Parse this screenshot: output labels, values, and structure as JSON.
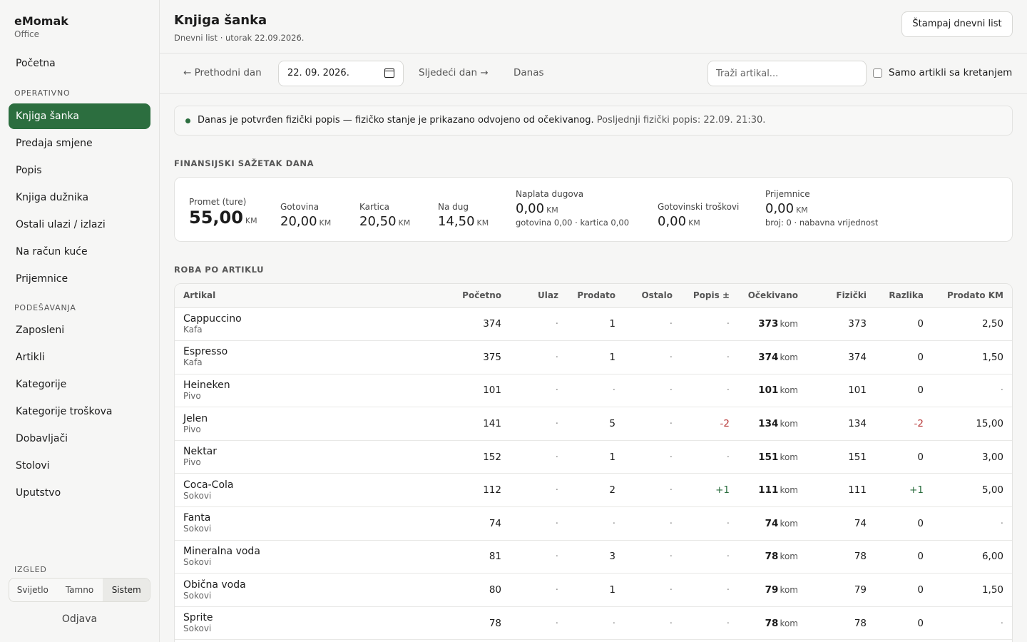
{
  "brand": {
    "name": "eMomak",
    "sub": "Office"
  },
  "nav": {
    "home": "Početna",
    "section_operative": "OPERATIVNO",
    "operative_items": [
      "Knjiga šanka",
      "Predaja smjene",
      "Popis",
      "Knjiga dužnika",
      "Ostali ulazi / izlazi",
      "Na račun kuće",
      "Prijemnice"
    ],
    "section_settings": "PODEŠAVANJA",
    "settings_items": [
      "Zaposleni",
      "Artikli",
      "Kategorije",
      "Kategorije troškova",
      "Dobavljači",
      "Stolovi",
      "Uputstvo"
    ],
    "section_appearance": "IZGLED",
    "theme_options": [
      "Svijetlo",
      "Tamno",
      "Sistem"
    ],
    "theme_selected": "Sistem",
    "logout": "Odjava"
  },
  "header": {
    "title": "Knjiga šanka",
    "subtitle": "Dnevni list · utorak 22.09.2026.",
    "print_button": "Štampaj dnevni list"
  },
  "toolbar": {
    "prev_day": "← Prethodni dan",
    "date_value": "22. 09. 2026.",
    "next_day": "Sljedeći dan →",
    "today": "Danas",
    "search_placeholder": "Traži artikal...",
    "movement_only_label": "Samo artikli sa kretanjem",
    "movement_only_checked": false
  },
  "notice": {
    "text": "Danas je potvrđen fizički popis — fizičko stanje je prikazano odvojeno od očekivanog.",
    "muted": "Posljednji fizički popis: 22.09. 21:30."
  },
  "summary": {
    "section_label": "FINANSIJSKI SAŽETAK DANA",
    "turnover": {
      "label": "Promet (ture)",
      "value": "55,00",
      "unit": "KM"
    },
    "cash": {
      "label": "Gotovina",
      "value": "20,00",
      "unit": "KM"
    },
    "card": {
      "label": "Kartica",
      "value": "20,50",
      "unit": "KM"
    },
    "debt": {
      "label": "Na dug",
      "value": "14,50",
      "unit": "KM"
    },
    "debt_collection": {
      "label": "Naplata dugova",
      "value": "0,00",
      "unit": "KM",
      "note": "gotovina 0,00 · kartica 0,00"
    },
    "cash_expenses": {
      "label": "Gotovinski troškovi",
      "value": "0,00",
      "unit": "KM"
    },
    "receipts": {
      "label": "Prijemnice",
      "value": "0,00",
      "unit": "KM",
      "note": "broj: 0 · nabavna vrijednost"
    }
  },
  "goods": {
    "section_label": "ROBA PO ARTIKLU",
    "columns": [
      "Artikal",
      "Početno",
      "Ulaz",
      "Prodato",
      "Ostalo",
      "Popis ±",
      "Očekivano",
      "Fizički",
      "Razlika",
      "Prodato KM"
    ],
    "unit": "kom",
    "rows": [
      {
        "name": "Cappuccino",
        "category": "Kafa",
        "start": "374",
        "in": "·",
        "sold": "1",
        "other": "·",
        "count": "·",
        "expected": "373",
        "physical": "373",
        "diff": "0",
        "sold_km": "2,50"
      },
      {
        "name": "Espresso",
        "category": "Kafa",
        "start": "375",
        "in": "·",
        "sold": "1",
        "other": "·",
        "count": "·",
        "expected": "374",
        "physical": "374",
        "diff": "0",
        "sold_km": "1,50"
      },
      {
        "name": "Heineken",
        "category": "Pivo",
        "start": "101",
        "in": "·",
        "sold": "·",
        "other": "·",
        "count": "·",
        "expected": "101",
        "physical": "101",
        "diff": "0",
        "sold_km": "·"
      },
      {
        "name": "Jelen",
        "category": "Pivo",
        "start": "141",
        "in": "·",
        "sold": "5",
        "other": "·",
        "count": "-2",
        "expected": "134",
        "physical": "134",
        "diff": "-2",
        "sold_km": "15,00"
      },
      {
        "name": "Nektar",
        "category": "Pivo",
        "start": "152",
        "in": "·",
        "sold": "1",
        "other": "·",
        "count": "·",
        "expected": "151",
        "physical": "151",
        "diff": "0",
        "sold_km": "3,00"
      },
      {
        "name": "Coca-Cola",
        "category": "Sokovi",
        "start": "112",
        "in": "·",
        "sold": "2",
        "other": "·",
        "count": "+1",
        "expected": "111",
        "physical": "111",
        "diff": "+1",
        "sold_km": "5,00"
      },
      {
        "name": "Fanta",
        "category": "Sokovi",
        "start": "74",
        "in": "·",
        "sold": "·",
        "other": "·",
        "count": "·",
        "expected": "74",
        "physical": "74",
        "diff": "0",
        "sold_km": "·"
      },
      {
        "name": "Mineralna voda",
        "category": "Sokovi",
        "start": "81",
        "in": "·",
        "sold": "3",
        "other": "·",
        "count": "·",
        "expected": "78",
        "physical": "78",
        "diff": "0",
        "sold_km": "6,00"
      },
      {
        "name": "Obična voda",
        "category": "Sokovi",
        "start": "80",
        "in": "·",
        "sold": "1",
        "other": "·",
        "count": "·",
        "expected": "79",
        "physical": "79",
        "diff": "0",
        "sold_km": "1,50"
      },
      {
        "name": "Sprite",
        "category": "Sokovi",
        "start": "78",
        "in": "·",
        "sold": "·",
        "other": "·",
        "count": "·",
        "expected": "78",
        "physical": "78",
        "diff": "0",
        "sold_km": "·"
      }
    ]
  },
  "colors": {
    "accent": "#2c6e3f",
    "negative": "#b83a3a",
    "positive": "#2c6e3f"
  }
}
